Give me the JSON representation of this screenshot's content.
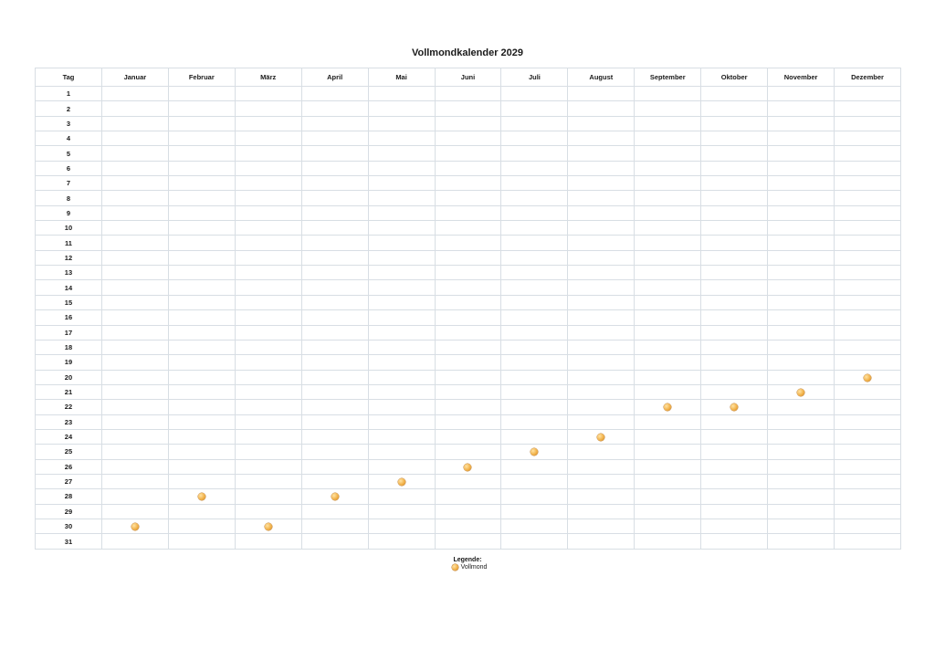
{
  "title": "Vollmondkalender 2029",
  "header": {
    "day_label": "Tag",
    "months": [
      "Januar",
      "Februar",
      "März",
      "April",
      "Mai",
      "Juni",
      "Juli",
      "August",
      "September",
      "Oktober",
      "November",
      "Dezember"
    ]
  },
  "days": [
    1,
    2,
    3,
    4,
    5,
    6,
    7,
    8,
    9,
    10,
    11,
    12,
    13,
    14,
    15,
    16,
    17,
    18,
    19,
    20,
    21,
    22,
    23,
    24,
    25,
    26,
    27,
    28,
    29,
    30,
    31
  ],
  "full_moons": [
    {
      "month": "Januar",
      "day": 30
    },
    {
      "month": "Februar",
      "day": 28
    },
    {
      "month": "März",
      "day": 30
    },
    {
      "month": "April",
      "day": 28
    },
    {
      "month": "Mai",
      "day": 27
    },
    {
      "month": "Juni",
      "day": 26
    },
    {
      "month": "Juli",
      "day": 25
    },
    {
      "month": "August",
      "day": 24
    },
    {
      "month": "September",
      "day": 22
    },
    {
      "month": "Oktober",
      "day": 22
    },
    {
      "month": "November",
      "day": 21
    },
    {
      "month": "Dezember",
      "day": 20
    }
  ],
  "legend": {
    "title": "Legende:",
    "items": [
      {
        "icon": "full-moon-icon",
        "label": "Vollmond"
      }
    ]
  },
  "colors": {
    "moon": "#f2b24a",
    "grid": "#d8dee4"
  }
}
